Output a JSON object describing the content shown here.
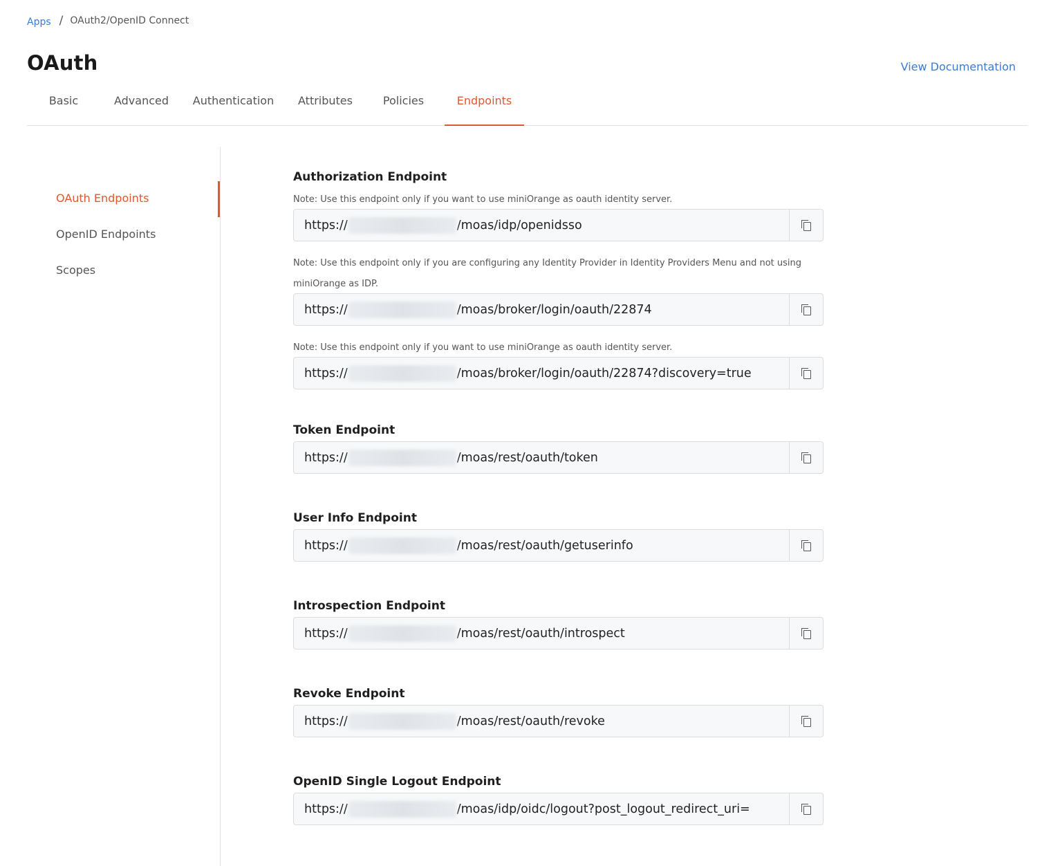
{
  "breadcrumb": {
    "apps": "Apps",
    "separator": "/",
    "current": "OAuth2/OpenID Connect"
  },
  "page": {
    "title": "OAuth",
    "view_doc": "View Documentation"
  },
  "tabs": [
    "Basic",
    "Advanced",
    "Authentication",
    "Attributes",
    "Policies",
    "Endpoints"
  ],
  "active_tab": "Endpoints",
  "sidebar": {
    "items": [
      "OAuth Endpoints",
      "OpenID Endpoints",
      "Scopes"
    ],
    "active": "OAuth Endpoints"
  },
  "sections": {
    "authorization": {
      "title": "Authorization Endpoint",
      "note1": "Note: Use this endpoint only if you want to use miniOrange as oauth identity server.",
      "field1": {
        "prefix": "https://",
        "suffix": "/moas/idp/openidsso"
      },
      "note2": "Note: Use this endpoint only if you are configuring any Identity Provider in Identity Providers Menu and not using miniOrange as IDP.",
      "field2": {
        "prefix": "https://",
        "suffix": "/moas/broker/login/oauth/22874"
      },
      "note3": "Note: Use this endpoint only if you want to use miniOrange as oauth identity server.",
      "field3": {
        "prefix": "https://",
        "suffix": "/moas/broker/login/oauth/22874?discovery=true"
      }
    },
    "token": {
      "title": "Token Endpoint",
      "field": {
        "prefix": "https://",
        "suffix": "/moas/rest/oauth/token"
      }
    },
    "userinfo": {
      "title": "User Info Endpoint",
      "field": {
        "prefix": "https://",
        "suffix": "/moas/rest/oauth/getuserinfo"
      }
    },
    "introspection": {
      "title": "Introspection Endpoint",
      "field": {
        "prefix": "https://",
        "suffix": "/moas/rest/oauth/introspect"
      }
    },
    "revoke": {
      "title": "Revoke Endpoint",
      "field": {
        "prefix": "https://",
        "suffix": "/moas/rest/oauth/revoke"
      }
    },
    "logout": {
      "title": "OpenID Single Logout Endpoint",
      "field": {
        "prefix": "https://",
        "suffix": "/moas/idp/oidc/logout?post_logout_redirect_uri="
      }
    }
  },
  "colors": {
    "accent": "#e0582b",
    "link": "#3a7bd5",
    "field_bg": "#f7f8f9",
    "border": "#dcdcdc"
  }
}
